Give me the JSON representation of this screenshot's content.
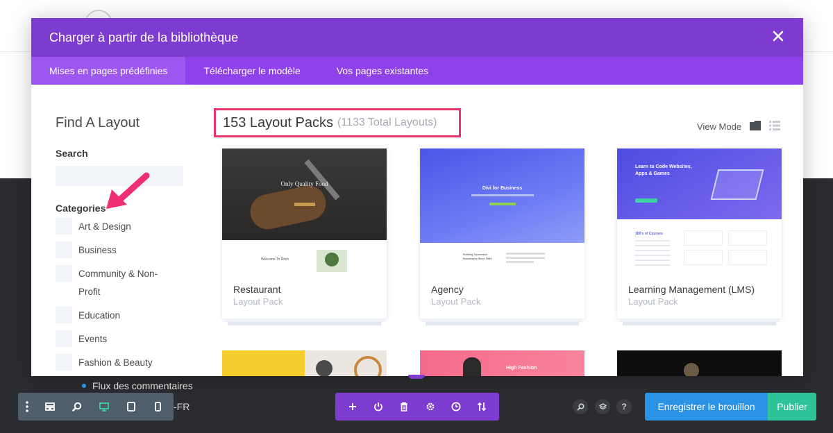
{
  "modal": {
    "title": "Charger à partir de la bibliothèque",
    "close_icon": "close-icon",
    "tabs": [
      {
        "label": "Mises en pages prédéfinies",
        "active": true
      },
      {
        "label": "Télécharger le modèle",
        "active": false
      },
      {
        "label": "Vos pages existantes",
        "active": false
      }
    ]
  },
  "sidebar": {
    "title": "Find A Layout",
    "search_label": "Search",
    "search_value": "",
    "categories_label": "Categories",
    "categories": [
      "Art & Design",
      "Business",
      "Community & Non-Profit",
      "Education",
      "Events",
      "Fashion & Beauty"
    ]
  },
  "main": {
    "packs_count": "153 Layout Packs",
    "packs_total": "(1133 Total Layouts)",
    "view_mode_label": "View Mode",
    "cards": [
      {
        "name": "Restaurant",
        "type": "Layout Pack",
        "thumb_text": "Only Quality Food",
        "thumb_sub": "Welcome To Ritch"
      },
      {
        "name": "Agency",
        "type": "Layout Pack",
        "thumb_text": "Divi for Business",
        "thumb_sub": "Building Successful Businesses Since 1983"
      },
      {
        "name": "Learning Management (LMS)",
        "type": "Layout Pack",
        "thumb_text": "Learn to Code Websites, Apps & Games",
        "thumb_sub": "100's of Courses"
      }
    ],
    "second_row_thumb_texts": [
      "",
      "High Fashion",
      ""
    ]
  },
  "background": {
    "link_text": "Flux des commentaires",
    "fr_text": "-FR"
  },
  "toolbar": {
    "left_icons": [
      "more-icon",
      "wireframe-icon",
      "zoom-icon",
      "desktop-icon",
      "tablet-icon",
      "phone-icon"
    ],
    "mid_icons": [
      "add-icon",
      "power-icon",
      "trash-icon",
      "settings-icon",
      "history-icon",
      "portability-icon"
    ],
    "right_icons": [
      "search-icon",
      "layers-icon",
      "help-icon"
    ],
    "help_glyph": "?",
    "draft_label": "Enregistrer le brouillon",
    "publish_label": "Publier"
  },
  "colors": {
    "header": "#7e3bd0",
    "tabs": "#8f42ec",
    "highlight": "#e8336b",
    "draft": "#2a93e6",
    "publish": "#2fc39a"
  }
}
